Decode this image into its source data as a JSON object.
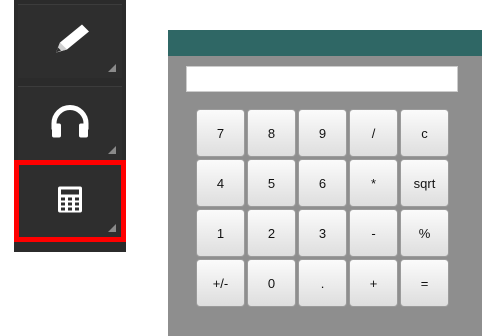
{
  "toolbar": {
    "items": [
      {
        "name": "pencil-icon"
      },
      {
        "name": "headphones-icon"
      },
      {
        "name": "calculator-icon",
        "selected": true
      }
    ]
  },
  "calculator": {
    "display_value": "",
    "keys": [
      [
        "7",
        "8",
        "9",
        "/",
        "c"
      ],
      [
        "4",
        "5",
        "6",
        "*",
        "sqrt"
      ],
      [
        "1",
        "2",
        "3",
        "-",
        "%"
      ],
      [
        "+/-",
        "0",
        ".",
        "+",
        "="
      ]
    ]
  },
  "colors": {
    "header": "#2f6765",
    "body": "#8e8e8e",
    "selection": "#ff0000"
  }
}
